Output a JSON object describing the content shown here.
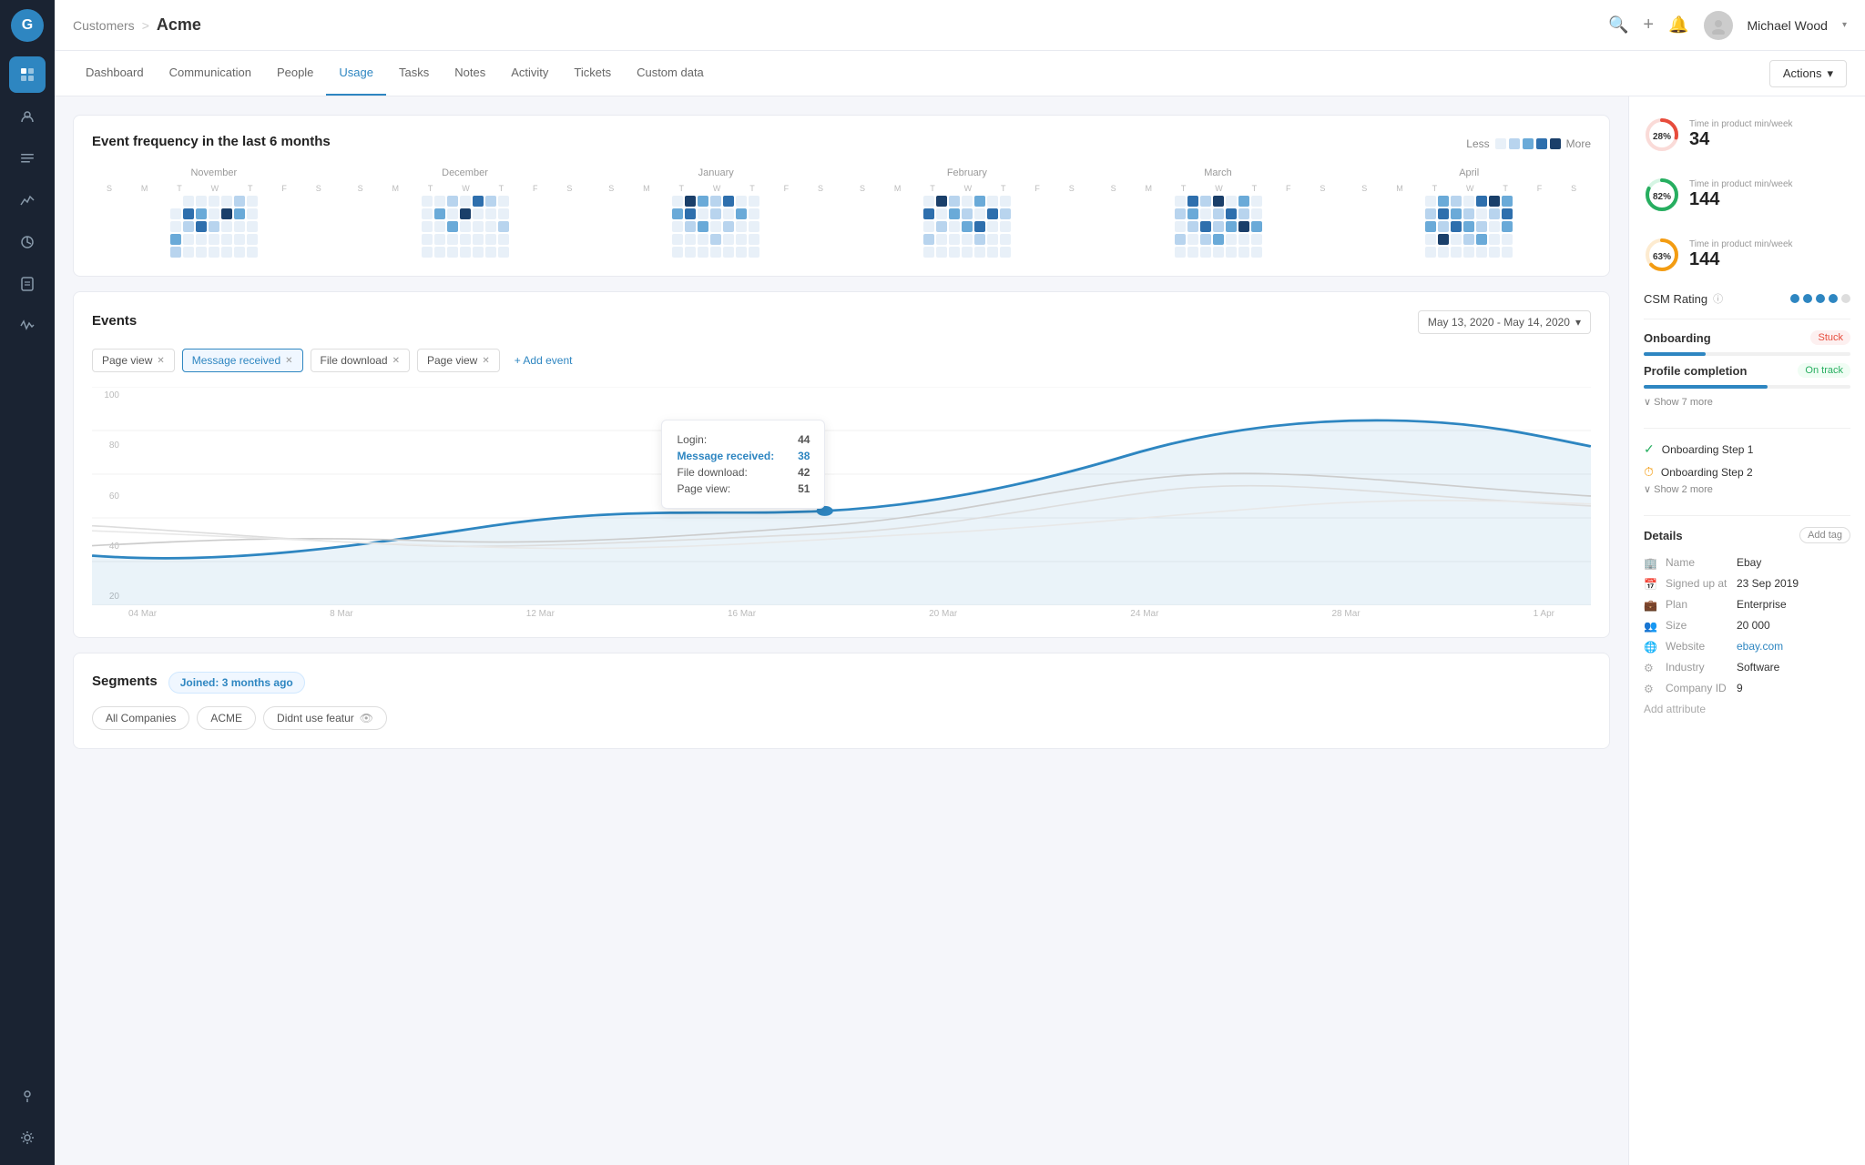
{
  "app": {
    "logo": "G"
  },
  "breadcrumb": {
    "parent": "Customers",
    "separator": ">",
    "current": "Acme"
  },
  "header": {
    "search_icon": "🔍",
    "add_icon": "+",
    "bell_icon": "🔔",
    "user_name": "Michael Wood",
    "user_avatar": "👤"
  },
  "nav_tabs": [
    {
      "label": "Dashboard",
      "active": false
    },
    {
      "label": "Communication",
      "active": false
    },
    {
      "label": "People",
      "active": false
    },
    {
      "label": "Usage",
      "active": true
    },
    {
      "label": "Tasks",
      "active": false
    },
    {
      "label": "Notes",
      "active": false
    },
    {
      "label": "Activity",
      "active": false
    },
    {
      "label": "Tickets",
      "active": false
    },
    {
      "label": "Custom data",
      "active": false
    }
  ],
  "actions_btn": "Actions",
  "heatmap": {
    "title": "Event frequency in the last 6 months",
    "legend_less": "Less",
    "legend_more": "More",
    "months": [
      "November",
      "December",
      "January",
      "February",
      "March",
      "April"
    ]
  },
  "events": {
    "title": "Events",
    "date_range": "May 13, 2020 - May 14, 2020",
    "tags": [
      {
        "label": "Page view",
        "active": false
      },
      {
        "label": "Message received",
        "active": true
      },
      {
        "label": "File download",
        "active": false
      },
      {
        "label": "Page view",
        "active": false
      }
    ],
    "add_event": "+ Add event",
    "x_labels": [
      "04 Mar",
      "8 Mar",
      "12 Mar",
      "16 Mar",
      "20 Mar",
      "24 Mar",
      "28 Mar",
      "1 Apr"
    ],
    "y_labels": [
      "100",
      "80",
      "60",
      "40",
      "20"
    ],
    "tooltip": {
      "login_label": "Login:",
      "login_val": "44",
      "msg_label": "Message received:",
      "msg_val": "38",
      "file_label": "File download:",
      "file_val": "42",
      "page_label": "Page view:",
      "page_val": "51"
    }
  },
  "segments": {
    "title": "Segments",
    "joined_label": "Joined:",
    "joined_value": "3 months ago",
    "tags": [
      "All Companies",
      "ACME",
      "Didnt use featur"
    ]
  },
  "right_panel": {
    "metrics": [
      {
        "label": "Time in product min/week",
        "value": "34",
        "percent": 28,
        "color": "#e74c3c",
        "track_color": "#fadbd8"
      },
      {
        "label": "Time in product min/week",
        "value": "144",
        "percent": 82,
        "color": "#27ae60",
        "track_color": "#d5f5e3"
      },
      {
        "label": "Time in product min/week",
        "value": "144",
        "percent": 63,
        "color": "#f39c12",
        "track_color": "#fdebd0"
      }
    ],
    "csm": {
      "label": "CSM Rating",
      "dots": [
        "#2e86c1",
        "#2e86c1",
        "#2e86c1",
        "#2e86c1",
        "#ddd"
      ]
    },
    "onboarding": {
      "label": "Onboarding",
      "status": "Stuck",
      "progress": 30
    },
    "profile": {
      "label": "Profile completion",
      "status": "On track",
      "progress": 60
    },
    "show_more_1": "∨ Show 7 more",
    "steps": [
      {
        "label": "Onboarding Step 1",
        "icon": "✓",
        "type": "green"
      },
      {
        "label": "Onboarding Step 2",
        "icon": "⏱",
        "type": "orange"
      }
    ],
    "show_more_2": "∨ Show 2 more",
    "details": {
      "title": "Details",
      "add_tag": "Add tag",
      "rows": [
        {
          "icon": "🏢",
          "label": "Name",
          "value": "Ebay"
        },
        {
          "icon": "📅",
          "label": "Signed up at",
          "value": "23 Sep 2019"
        },
        {
          "icon": "💼",
          "label": "Plan",
          "value": "Enterprise"
        },
        {
          "icon": "👥",
          "label": "Size",
          "value": "20 000"
        },
        {
          "icon": "🌐",
          "label": "Website",
          "value": "ebay.com"
        },
        {
          "icon": "⚙",
          "label": "Industry",
          "value": "Software"
        },
        {
          "icon": "⚙",
          "label": "Company ID",
          "value": "9"
        }
      ],
      "add_attribute": "Add attribute"
    }
  }
}
